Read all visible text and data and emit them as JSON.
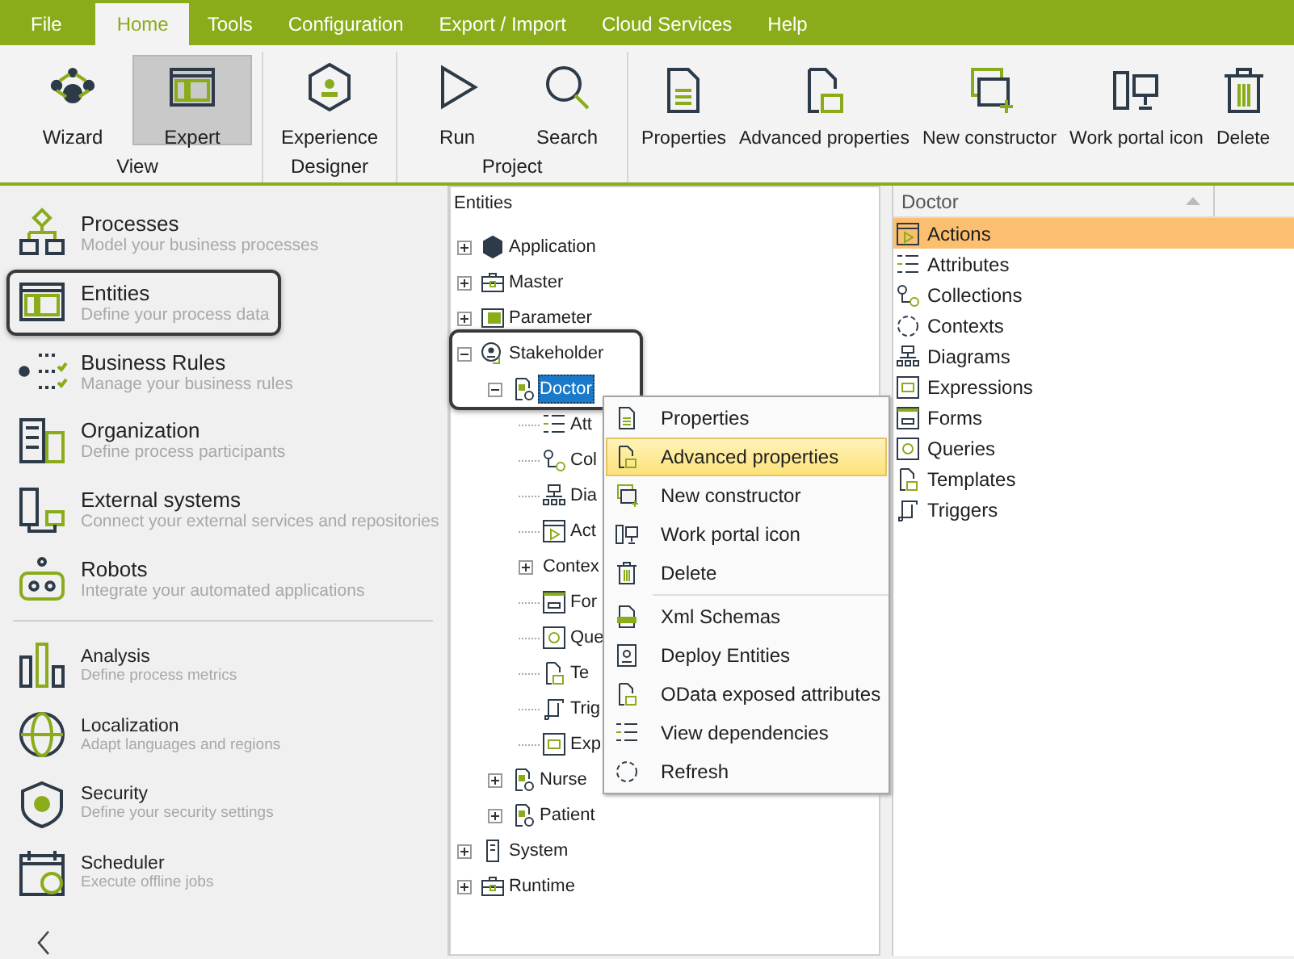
{
  "menu_tabs": [
    {
      "label": "File",
      "selected": false
    },
    {
      "label": "Home",
      "selected": true
    },
    {
      "label": "Tools",
      "selected": false
    },
    {
      "label": "Configuration",
      "selected": false
    },
    {
      "label": "Export / Import",
      "selected": false
    },
    {
      "label": "Cloud Services",
      "selected": false
    },
    {
      "label": "Help",
      "selected": false
    }
  ],
  "ribbon": {
    "groups": [
      {
        "label": "View",
        "buttons": [
          {
            "label": "Wizard",
            "selected": false
          },
          {
            "label": "Expert",
            "selected": true
          }
        ]
      },
      {
        "label": "Designer",
        "buttons": [
          {
            "label": "Experience",
            "selected": false
          }
        ]
      },
      {
        "label": "Project",
        "buttons": [
          {
            "label": "Run",
            "selected": false
          },
          {
            "label": "Search",
            "selected": false
          }
        ]
      },
      {
        "buttons": [
          {
            "label": "Properties",
            "selected": false
          },
          {
            "label": "Advanced properties",
            "selected": false
          },
          {
            "label": "New constructor",
            "selected": false
          },
          {
            "label": "Work portal icon",
            "selected": false
          },
          {
            "label": "Delete",
            "selected": false
          }
        ]
      }
    ]
  },
  "sidebar": {
    "items": [
      {
        "kind": "module",
        "title": "Processes",
        "subtitle": "Model your business processes",
        "highlighted": false
      },
      {
        "kind": "module",
        "title": "Entities",
        "subtitle": "Define your process data",
        "highlighted": true
      },
      {
        "kind": "module",
        "title": "Business Rules",
        "subtitle": "Manage your business rules",
        "highlighted": false
      },
      {
        "kind": "module",
        "title": "Organization",
        "subtitle": "Define process participants",
        "highlighted": false
      },
      {
        "kind": "module",
        "title": "External systems",
        "subtitle": "Connect your external services and repositories",
        "highlighted": false
      },
      {
        "kind": "module",
        "title": "Robots",
        "subtitle": "Integrate your automated applications",
        "highlighted": false
      },
      {
        "kind": "tool",
        "title": "Analysis",
        "subtitle": "Define process metrics",
        "highlighted": false
      },
      {
        "kind": "tool",
        "title": "Localization",
        "subtitle": "Adapt languages and regions",
        "highlighted": false
      },
      {
        "kind": "tool",
        "title": "Security",
        "subtitle": "Define your security settings",
        "highlighted": false
      },
      {
        "kind": "tool",
        "title": "Scheduler",
        "subtitle": "Execute offline jobs",
        "highlighted": false
      }
    ]
  },
  "tree": {
    "title": "Entities",
    "items": [
      {
        "label": "Application",
        "kind": "group",
        "expanded": false,
        "selected": false,
        "highlighted": false
      },
      {
        "label": "Master",
        "kind": "group",
        "expanded": false,
        "selected": false,
        "highlighted": false
      },
      {
        "label": "Parameter",
        "kind": "group",
        "expanded": false,
        "selected": false,
        "highlighted": false
      },
      {
        "label": "Stakeholder",
        "kind": "group",
        "expanded": true,
        "selected": false,
        "highlighted": true,
        "children": [
          {
            "label": "Doctor",
            "kind": "group",
            "expanded": true,
            "selected": true,
            "highlighted": false,
            "children": [
              {
                "label": "Att",
                "kind": "leaf",
                "selected": false,
                "highlighted": false
              },
              {
                "label": "Col",
                "kind": "leaf",
                "selected": false,
                "highlighted": false
              },
              {
                "label": "Dia",
                "kind": "leaf",
                "selected": false,
                "highlighted": false
              },
              {
                "label": "Act",
                "kind": "leaf",
                "selected": false,
                "highlighted": false
              },
              {
                "label": "Contex",
                "kind": "group",
                "expanded": false,
                "selected": false,
                "highlighted": false
              },
              {
                "label": "For",
                "kind": "leaf",
                "selected": false,
                "highlighted": false
              },
              {
                "label": "Que",
                "kind": "leaf",
                "selected": false,
                "highlighted": false
              },
              {
                "label": "Te",
                "kind": "leaf",
                "selected": false,
                "highlighted": false
              },
              {
                "label": "Trig",
                "kind": "leaf",
                "selected": false,
                "highlighted": false
              },
              {
                "label": "Exp",
                "kind": "leaf",
                "selected": false,
                "highlighted": false
              }
            ]
          },
          {
            "label": "Nurse",
            "kind": "group",
            "expanded": false,
            "selected": false,
            "highlighted": false
          },
          {
            "label": "Patient",
            "kind": "group",
            "expanded": false,
            "selected": false,
            "highlighted": false
          }
        ]
      },
      {
        "label": "System",
        "kind": "group",
        "expanded": false,
        "selected": false,
        "highlighted": false
      },
      {
        "label": "Runtime",
        "kind": "group",
        "expanded": false,
        "selected": false,
        "highlighted": false
      }
    ]
  },
  "context_menu": {
    "sections": [
      {
        "items": [
          {
            "label": "Properties",
            "selected": false
          },
          {
            "label": "Advanced properties",
            "selected": true
          },
          {
            "label": "New constructor",
            "selected": false
          },
          {
            "label": "Work portal icon",
            "selected": false
          },
          {
            "label": "Delete",
            "selected": false
          }
        ]
      },
      {
        "items": [
          {
            "label": "Xml Schemas",
            "selected": false
          },
          {
            "label": "Deploy Entities",
            "selected": false
          },
          {
            "label": "OData exposed attributes",
            "selected": false
          },
          {
            "label": "View dependencies",
            "selected": false
          },
          {
            "label": "Refresh",
            "selected": false
          }
        ]
      }
    ]
  },
  "entity_list": {
    "header": "Doctor",
    "items": [
      {
        "label": "Actions",
        "selected": true
      },
      {
        "label": "Attributes",
        "selected": false
      },
      {
        "label": "Collections",
        "selected": false
      },
      {
        "label": "Contexts",
        "selected": false
      },
      {
        "label": "Diagrams",
        "selected": false
      },
      {
        "label": "Expressions",
        "selected": false
      },
      {
        "label": "Forms",
        "selected": false
      },
      {
        "label": "Queries",
        "selected": false
      },
      {
        "label": "Templates",
        "selected": false
      },
      {
        "label": "Triggers",
        "selected": false
      }
    ]
  }
}
